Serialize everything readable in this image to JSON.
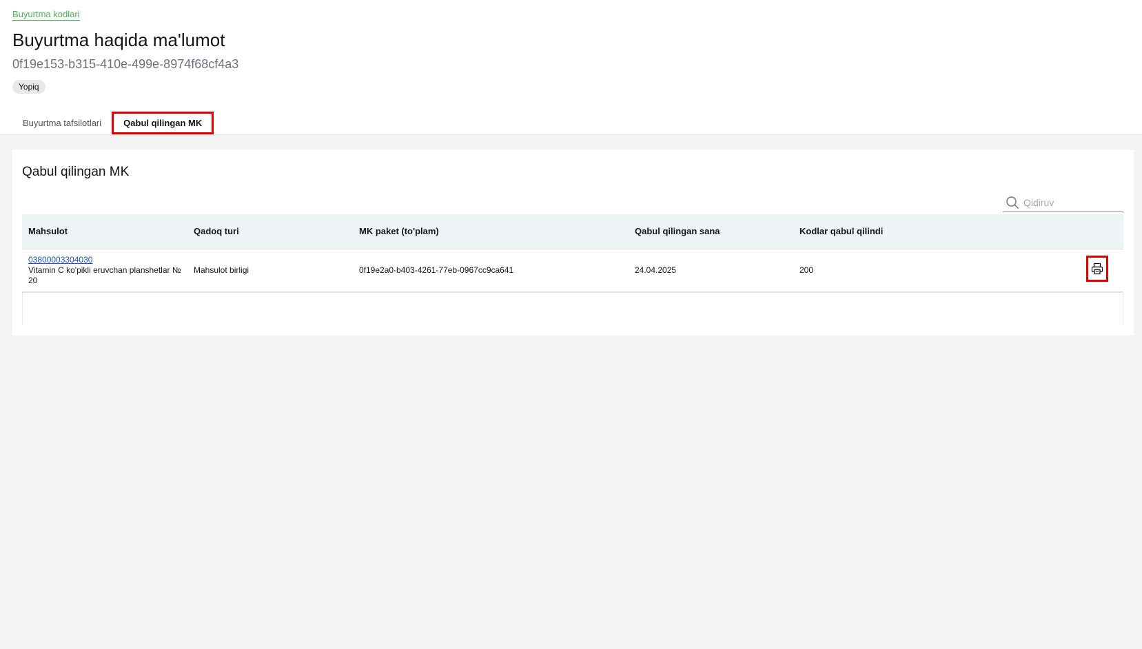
{
  "breadcrumb": {
    "label": "Buyurtma kodlari"
  },
  "page": {
    "title": "Buyurtma haqida ma'lumot",
    "order_id": "0f19e153-b315-410e-499e-8974f68cf4a3",
    "status": "Yopiq"
  },
  "tabs": [
    {
      "label": "Buyurtma tafsilotlari",
      "active": false
    },
    {
      "label": "Qabul qilingan MK",
      "active": true
    }
  ],
  "card": {
    "title": "Qabul qilingan MK",
    "search": {
      "placeholder": "Qidiruv",
      "value": ""
    },
    "table": {
      "columns": [
        "Mahsulot",
        "Qadoq turi",
        "MK paket (to'plam)",
        "Qabul qilingan sana",
        "Kodlar qabul qilindi"
      ],
      "rows": [
        {
          "product_code": "03800003304030",
          "product_name": "Vitamin C ko'pikli eruvchan planshetlar № 20",
          "package_type": "Mahsulot birligi",
          "mk_package": "0f19e2a0-b403-4261-77eb-0967cc9ca641",
          "received_date": "24.04.2025",
          "codes_received": "200"
        }
      ]
    }
  },
  "colors": {
    "accent_green": "#4caf50",
    "link_blue": "#1a56c8",
    "highlight_red": "#e00000",
    "table_header_bg": "#eef4f5",
    "page_bg": "#f4f4f3"
  },
  "icons": {
    "search": "search-icon",
    "print": "printer-icon"
  }
}
